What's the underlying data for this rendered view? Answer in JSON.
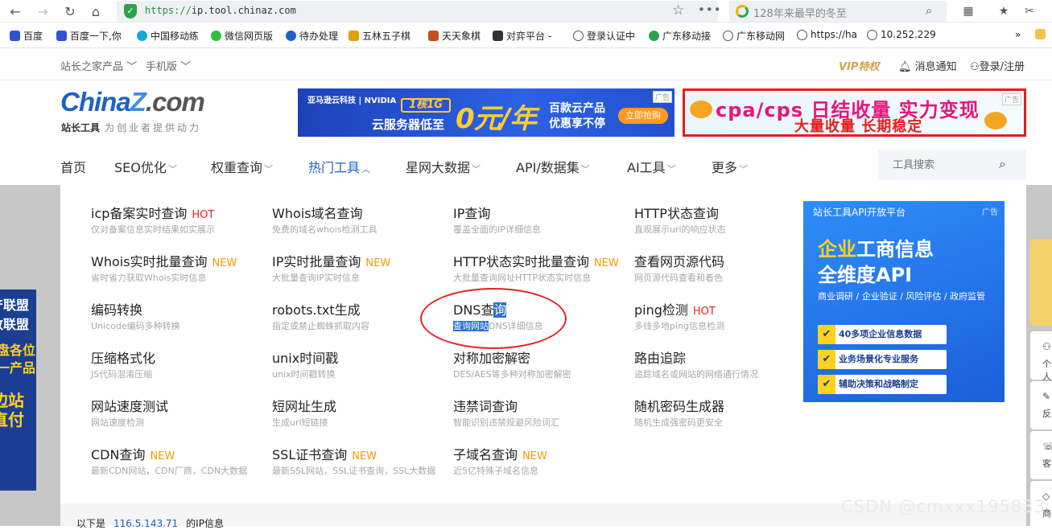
{
  "browser": {
    "url_scheme": "https://",
    "url_host": "ip.tool.chinaz.com",
    "search_text": "128年来最早的冬至",
    "bookmarks": [
      {
        "label": "百度",
        "color": "#2b55d6"
      },
      {
        "label": "百度一下,你",
        "color": "#2b55d6"
      },
      {
        "label": "中国移动练",
        "color": "#1aa3d9"
      },
      {
        "label": "微信网页版",
        "color": "#2fbf3a"
      },
      {
        "label": "待办处理",
        "color": "#1c62c4"
      },
      {
        "label": "五林五子棋",
        "color": "#e0a100"
      },
      {
        "label": "天天象棋",
        "color": "#c0501c"
      },
      {
        "label": "对弈平台 -",
        "color": "#333333"
      },
      {
        "label": "登录认证中",
        "color": "#555555"
      },
      {
        "label": "广东移动接",
        "color": "#2aa64a"
      },
      {
        "label": "广东移动网",
        "color": "#555555"
      },
      {
        "label": "https://ha",
        "color": "#555555"
      },
      {
        "label": "10.252.229",
        "color": "#555555"
      }
    ]
  },
  "site_top": {
    "products": "站长之家产品",
    "mobile": "手机版",
    "vip": "VIP特权",
    "notice": "消息通知",
    "login": "登录/注册"
  },
  "logo": {
    "china": "China",
    "z": "Z",
    "com": ".com",
    "name": "站长工具",
    "slogan": "为创业者提供动力"
  },
  "ad1": {
    "brand": "亚马逊云科技 | NVIDIA",
    "badge": "1核1G",
    "low": "云服务器低至",
    "price": "0元/年",
    "r1": "百款云产品",
    "r2": "优惠享不停",
    "cta": "立即抢购",
    "tag": "广告"
  },
  "ad2": {
    "line1": "cpa/cps 日结收量 实力变现",
    "line2": "大量收量 长期稳定",
    "tag": "广告"
  },
  "nav": {
    "items": [
      {
        "label": "首页",
        "caret": ""
      },
      {
        "label": "SEO优化",
        "caret": "﹀"
      },
      {
        "label": "权重查询",
        "caret": "﹀"
      },
      {
        "label": "热门工具",
        "caret": "︿"
      },
      {
        "label": "星网大数据",
        "caret": "﹀"
      },
      {
        "label": "API/数据集",
        "caret": "﹀"
      },
      {
        "label": "AI工具",
        "caret": "﹀"
      },
      {
        "label": "更多",
        "caret": "﹀"
      }
    ],
    "search_placeholder": "工具搜索"
  },
  "tools": [
    {
      "name": "icp备案实时查询",
      "tag": "HOT",
      "desc": "仅对备案信息实时结果如实展示"
    },
    {
      "name": "Whois域名查询",
      "tag": "",
      "desc": "免费的域名whois检测工具"
    },
    {
      "name": "IP查询",
      "tag": "",
      "desc": "覆盖全面的IP详细信息"
    },
    {
      "name": "HTTP状态查询",
      "tag": "",
      "desc": "直观展示url的响应状态"
    },
    {
      "name": "Whois实时批量查询",
      "tag": "NEW",
      "desc": "省时省力获取Whois实时信息"
    },
    {
      "name": "IP实时批量查询",
      "tag": "NEW",
      "desc": "大批量查询IP实时信息"
    },
    {
      "name": "HTTP状态实时批量查询",
      "tag": "NEW",
      "desc": "大批量查询网址HTTP状态实时信息"
    },
    {
      "name": "查看网页源代码",
      "tag": "",
      "desc": "网页源代码查看和着色"
    },
    {
      "name": "编码转换",
      "tag": "",
      "desc": "Unicode编码多种转换"
    },
    {
      "name": "robots.txt生成",
      "tag": "",
      "desc": "指定或禁止蜘蛛抓取内容"
    },
    {
      "name": "DNS查",
      "name_hl": "询",
      "tag": "",
      "desc": "DNS详细信息",
      "desc_hl": "查询网站"
    },
    {
      "name": "ping检测",
      "tag": "HOT",
      "desc": "多线多地ping信息检测"
    },
    {
      "name": "压缩格式化",
      "tag": "",
      "desc": "JS代码混淆压缩"
    },
    {
      "name": "unix时间戳",
      "tag": "",
      "desc": "unix时间戳转换"
    },
    {
      "name": "对称加密解密",
      "tag": "",
      "desc": "DES/AES等多种对称加密解密"
    },
    {
      "name": "路由追踪",
      "tag": "",
      "desc": "追踪域名或网站的网络通行情况"
    },
    {
      "name": "网站速度测试",
      "tag": "",
      "desc": "网站速度检测"
    },
    {
      "name": "短网址生成",
      "tag": "",
      "desc": "生成url短链接"
    },
    {
      "name": "违禁词查询",
      "tag": "",
      "desc": "智能识别违禁规避风险词汇"
    },
    {
      "name": "随机密码生成器",
      "tag": "",
      "desc": "随机生成强密码更安全"
    },
    {
      "name": "CDN查询",
      "tag": "NEW",
      "desc": "最新CDN网站，CDN厂商，CDN大数据"
    },
    {
      "name": "SSL证书查询",
      "tag": "NEW",
      "desc": "最新SSL网站，SSL证书查询，SSL大数据"
    },
    {
      "name": "子域名查询",
      "tag": "NEW",
      "desc": "近5亿特殊子域名信息"
    }
  ],
  "api_ad": {
    "header": "站长工具API开放平台",
    "tag": "广告",
    "h1a": "企业",
    "h1b": "工商信息",
    "h2": "全维度API",
    "sub": "商业调研 / 企业验证 / 风险评估 / 政府监管",
    "bullets": [
      "40多项企业信息数据",
      "业务场景化专业服务",
      "辅助决策和战略制定"
    ]
  },
  "left_banner": [
    "产联盟",
    "数联盟",
    "盘各位",
    "一产品",
    "边站",
    "直付"
  ],
  "side_buttons": [
    "个人",
    "反",
    "客",
    "商"
  ],
  "below": {
    "prefix": "以下是",
    "ip": "116.5.143.71",
    "suffix": "的IP信息"
  },
  "watermark": "CSDN @cmxxx195833"
}
